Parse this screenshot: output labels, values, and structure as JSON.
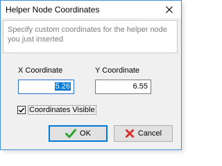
{
  "dialog": {
    "title": "Helper Node Coordinates",
    "instruction": "Specify custom coordinates for the helper node you just inserted"
  },
  "x_coordinate": {
    "label": "X Coordinate",
    "value": "5.26"
  },
  "y_coordinate": {
    "label": "Y Coordinate",
    "value": "6.55"
  },
  "coordinates_visible": {
    "label": "Coordinates Visible",
    "checked": true
  },
  "buttons": {
    "ok_label": "OK",
    "cancel_label": "Cancel"
  },
  "icons": {
    "close": "close-icon",
    "checkmark": "check-icon",
    "ok": "green-check-icon",
    "cancel": "red-x-icon"
  },
  "colors": {
    "accent": "#0078d7",
    "ok_icon": "#2fa12f",
    "cancel_icon": "#d8302a"
  }
}
